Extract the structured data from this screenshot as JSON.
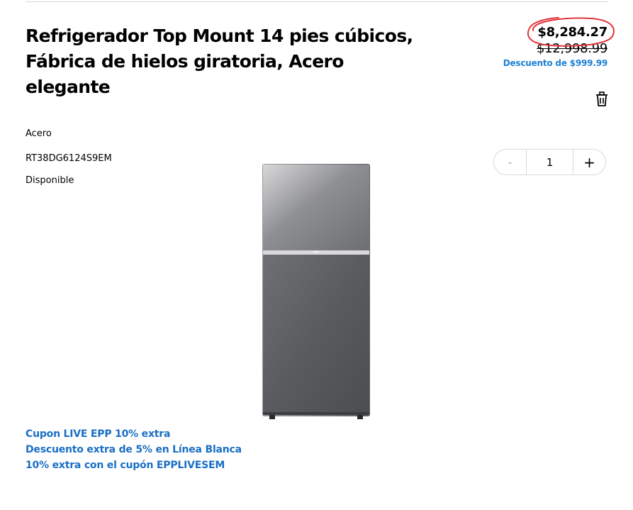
{
  "product": {
    "title": "Refrigerador Top Mount 14 pies cúbicos, Fábrica de hielos giratoria, Acero elegante",
    "color": "Acero",
    "model": "RT38DG6124S9EM",
    "availability": "Disponible"
  },
  "pricing": {
    "current": "$8,284.27",
    "original": "$12,998.99",
    "discount": "Descuento de $999.99",
    "accent_color": "#1a7fd4",
    "highlight_color": "#e0353a"
  },
  "quantity": {
    "minus": "-",
    "value": "1",
    "plus": "+"
  },
  "actions": {
    "remove_icon": "trash-icon"
  },
  "promos": [
    "Cupon LIVE EPP 10% extra",
    "Descuento extra de 5% en Línea Blanca",
    "10% extra con el cupón EPPLIVESEM"
  ]
}
